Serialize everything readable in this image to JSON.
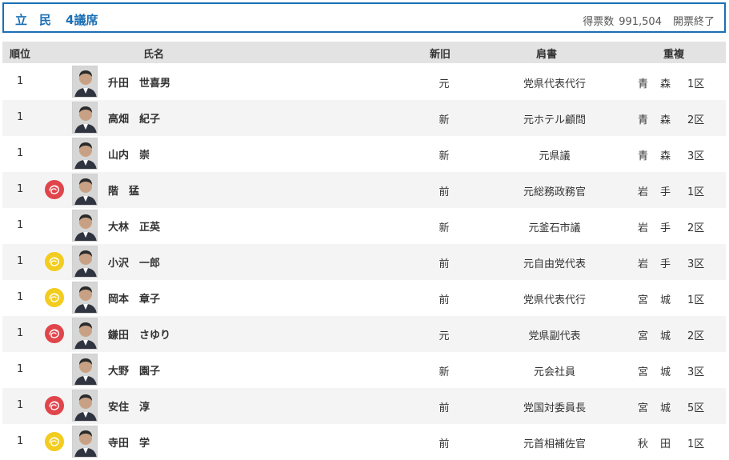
{
  "header": {
    "party": "立　民",
    "seats": "4議席",
    "votes_label": "得票数",
    "votes_value": "991,504",
    "count_status": "開票終了"
  },
  "columns": {
    "rank": "順位",
    "name": "氏名",
    "status": "新旧",
    "title": "肩書",
    "dual": "重複"
  },
  "colors": {
    "accent": "#1a6fb5",
    "rose_red": "#e0454b",
    "rose_yellow": "#f2cc1f"
  },
  "rows": [
    {
      "rank": "1",
      "rose": "",
      "name": "升田　世喜男",
      "status": "元",
      "title": "党県代表代行",
      "pref": "青　森",
      "district": "1区"
    },
    {
      "rank": "1",
      "rose": "",
      "name": "高畑　紀子",
      "status": "新",
      "title": "元ホテル顧問",
      "pref": "青　森",
      "district": "2区"
    },
    {
      "rank": "1",
      "rose": "",
      "name": "山内　崇",
      "status": "新",
      "title": "元県議",
      "pref": "青　森",
      "district": "3区"
    },
    {
      "rank": "1",
      "rose": "red",
      "name": "階　猛",
      "status": "前",
      "title": "元総務政務官",
      "pref": "岩　手",
      "district": "1区"
    },
    {
      "rank": "1",
      "rose": "",
      "name": "大林　正英",
      "status": "新",
      "title": "元釜石市議",
      "pref": "岩　手",
      "district": "2区"
    },
    {
      "rank": "1",
      "rose": "yellow",
      "name": "小沢　一郎",
      "status": "前",
      "title": "元自由党代表",
      "pref": "岩　手",
      "district": "3区"
    },
    {
      "rank": "1",
      "rose": "yellow",
      "name": "岡本　章子",
      "status": "前",
      "title": "党県代表代行",
      "pref": "宮　城",
      "district": "1区"
    },
    {
      "rank": "1",
      "rose": "red",
      "name": "鎌田　さゆり",
      "status": "元",
      "title": "党県副代表",
      "pref": "宮　城",
      "district": "2区"
    },
    {
      "rank": "1",
      "rose": "",
      "name": "大野　園子",
      "status": "新",
      "title": "元会社員",
      "pref": "宮　城",
      "district": "3区"
    },
    {
      "rank": "1",
      "rose": "red",
      "name": "安住　淳",
      "status": "前",
      "title": "党国対委員長",
      "pref": "宮　城",
      "district": "5区"
    },
    {
      "rank": "1",
      "rose": "yellow",
      "name": "寺田　学",
      "status": "前",
      "title": "元首相補佐官",
      "pref": "秋　田",
      "district": "1区"
    }
  ]
}
